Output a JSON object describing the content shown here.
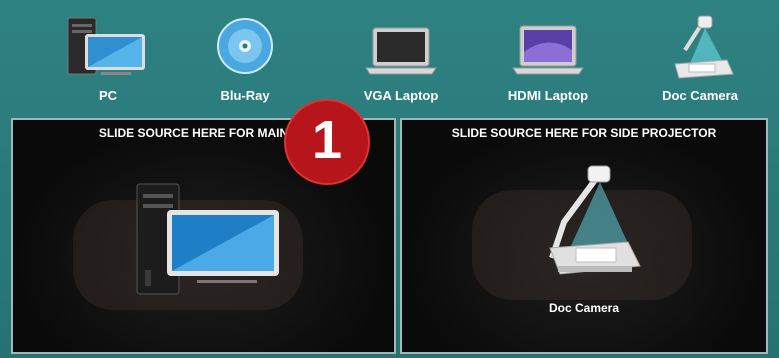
{
  "sources": [
    {
      "label": "PC",
      "icon": "pc-icon"
    },
    {
      "label": "Blu-Ray",
      "icon": "bluray-disc-icon"
    },
    {
      "label": "VGA Laptop",
      "icon": "laptop-icon"
    },
    {
      "label": "HDMI Laptop",
      "icon": "hdmi-laptop-icon"
    },
    {
      "label": "Doc Camera",
      "icon": "doc-camera-icon"
    }
  ],
  "main_panel": {
    "title": "SLIDE SOURCE HERE FOR MAIN PR",
    "current_icon": "pc-icon"
  },
  "side_panel": {
    "title": "SLIDE SOURCE HERE FOR SIDE PROJECTOR",
    "current_label": "Doc Camera",
    "current_icon": "doc-camera-icon"
  },
  "badge": {
    "text": "1",
    "color": "#b5151b"
  },
  "colors": {
    "background": "#2a7777",
    "panel": "#0f0f0f"
  }
}
